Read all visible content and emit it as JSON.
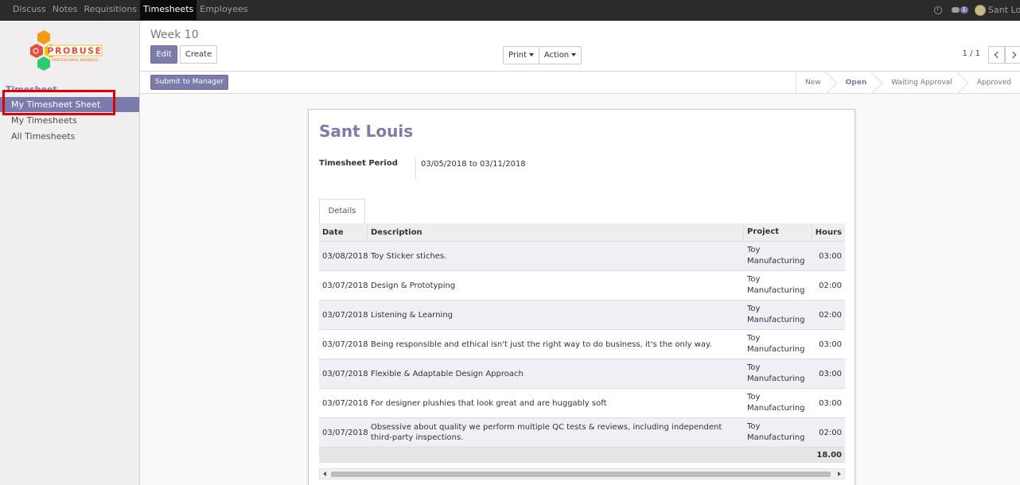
{
  "topmenu": {
    "items": [
      "Discuss",
      "Notes",
      "Requisitions",
      "Timesheets",
      "Employees"
    ],
    "active": "Timesheets"
  },
  "topright": {
    "chat_count": "1",
    "username": "Sant Louis"
  },
  "logo": {
    "brand": "PROBUSE",
    "tagline": "PROFESSIONAL BUSINESS"
  },
  "sidebar": {
    "heading": "Timesheet",
    "items": [
      "My Timesheet Sheet",
      "My Timesheets",
      "All Timesheets"
    ],
    "active": "My Timesheet Sheet"
  },
  "control_panel": {
    "breadcrumb": "Week 10",
    "edit_label": "Edit",
    "create_label": "Create",
    "print_label": "Print",
    "action_label": "Action",
    "pager": "1 / 1"
  },
  "statusbar": {
    "submit_label": "Submit to Manager",
    "stages": [
      "New",
      "Open",
      "Waiting Approval",
      "Approved"
    ],
    "current_stage": "Open"
  },
  "sheet": {
    "employee": "Sant Louis",
    "period_label": "Timesheet Period",
    "period_value": "03/05/2018 to 03/11/2018",
    "tab_label": "Details",
    "columns": [
      "Date",
      "Description",
      "Project",
      "Hours"
    ],
    "rows": [
      {
        "date": "03/08/2018",
        "description": "Toy Sticker stiches.",
        "project_1": "Toy",
        "project_2": "Manufacturing",
        "hours": "03:00"
      },
      {
        "date": "03/07/2018",
        "description": "Design & Prototyping",
        "project_1": "Toy",
        "project_2": "Manufacturing",
        "hours": "02:00"
      },
      {
        "date": "03/07/2018",
        "description": "Listening & Learning",
        "project_1": "Toy",
        "project_2": "Manufacturing",
        "hours": "02:00"
      },
      {
        "date": "03/07/2018",
        "description": "Being responsible and ethical isn't just the right way to do business, it's the only way.",
        "project_1": "Toy",
        "project_2": "Manufacturing",
        "hours": "03:00"
      },
      {
        "date": "03/07/2018",
        "description": "Flexible & Adaptable Design Approach",
        "project_1": "Toy",
        "project_2": "Manufacturing",
        "hours": "03:00"
      },
      {
        "date": "03/07/2018",
        "description": "For designer plushies that look great and are huggably soft",
        "project_1": "Toy",
        "project_2": "Manufacturing",
        "hours": "03:00"
      },
      {
        "date": "03/07/2018",
        "description": "Obsessive about quality we perform multiple QC tests & reviews, including independent third-party inspections.",
        "project_1": "Toy",
        "project_2": "Manufacturing",
        "hours": "02:00"
      }
    ],
    "total_hours": "18.00"
  },
  "colors": {
    "accent": "#7c7bad",
    "navbar": "#2b2b2b",
    "highlight_box": "#e00000"
  }
}
